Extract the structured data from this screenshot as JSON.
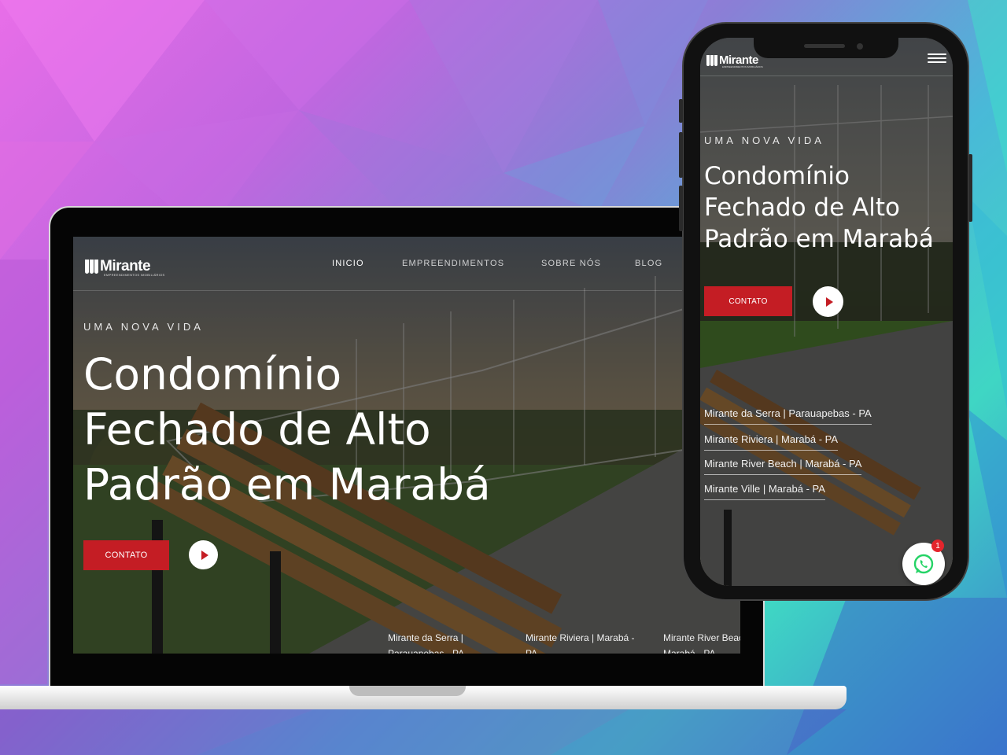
{
  "colors": {
    "accent": "#c41d24",
    "whatsapp": "#25d366"
  },
  "laptop": {
    "brand": "Mirante",
    "brand_sub": "EMPREENDIMENTOS IMOBILIÁRIOS",
    "nav": [
      "INICIO",
      "EMPREENDIMENTOS",
      "SOBRE NÓS",
      "BLOG"
    ],
    "kicker": "UMA NOVA VIDA",
    "title_lines": [
      "Condomínio",
      "Fechado de Alto",
      "Padrão em Marabá"
    ],
    "contact_label": "CONTATO",
    "links": [
      "Mirante da Serra | Parauapebas - PA",
      "Mirante Riviera | Marabá - PA",
      "Mirante River Beach | Marabá - PA"
    ]
  },
  "phone": {
    "brand": "Mirante",
    "brand_sub": "EMPREENDIMENTOS IMOBILIÁRIOS",
    "kicker": "UMA NOVA VIDA",
    "title_lines": [
      "Condomínio",
      "Fechado de Alto",
      "Padrão em Marabá"
    ],
    "contact_label": "CONTATO",
    "links": [
      "Mirante da Serra | Parauapebas - PA",
      "Mirante Riviera | Marabá - PA",
      "Mirante River Beach | Marabá - PA",
      "Mirante Ville | Marabá - PA"
    ],
    "whatsapp_badge": "1"
  }
}
